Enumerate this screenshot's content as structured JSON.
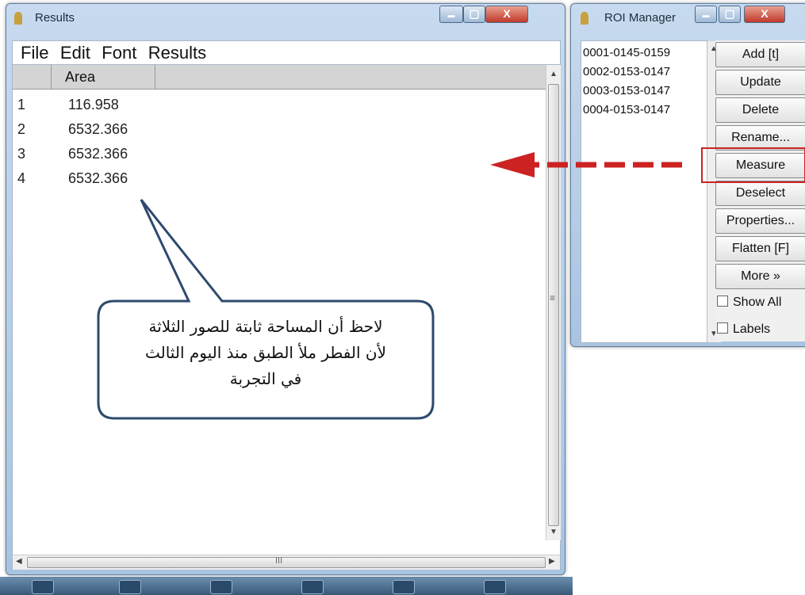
{
  "results_window": {
    "title": "Results",
    "menu": [
      "File",
      "Edit",
      "Font",
      "Results"
    ],
    "column_header": "Area",
    "rows": [
      {
        "index": "1",
        "area": "116.958"
      },
      {
        "index": "2",
        "area": "6532.366"
      },
      {
        "index": "3",
        "area": "6532.366"
      },
      {
        "index": "4",
        "area": "6532.366"
      }
    ],
    "hscroll_grip": "III",
    "vscroll_grip": "≡"
  },
  "callout": {
    "lines": [
      "لاحظ أن المساحة ثابتة للصور الثلاثة",
      "لأن الفطر ملأ الطبق منذ اليوم الثالث",
      "في التجربة"
    ]
  },
  "roi_manager": {
    "title": "ROI Manager",
    "rois": [
      "0001-0145-0159",
      "0002-0153-0147",
      "0003-0153-0147",
      "0004-0153-0147"
    ],
    "buttons": [
      "Add [t]",
      "Update",
      "Delete",
      "Rename...",
      "Measure",
      "Deselect",
      "Properties...",
      "Flatten [F]",
      "More »"
    ],
    "checkboxes": [
      "Show All",
      "Labels"
    ],
    "highlighted_button": "Measure"
  },
  "window_controls": {
    "minimize": "▬",
    "maximize": "▢",
    "close": "X"
  },
  "colors": {
    "annotation_red": "#cc2222",
    "title_blue": "#a9c4e0"
  }
}
